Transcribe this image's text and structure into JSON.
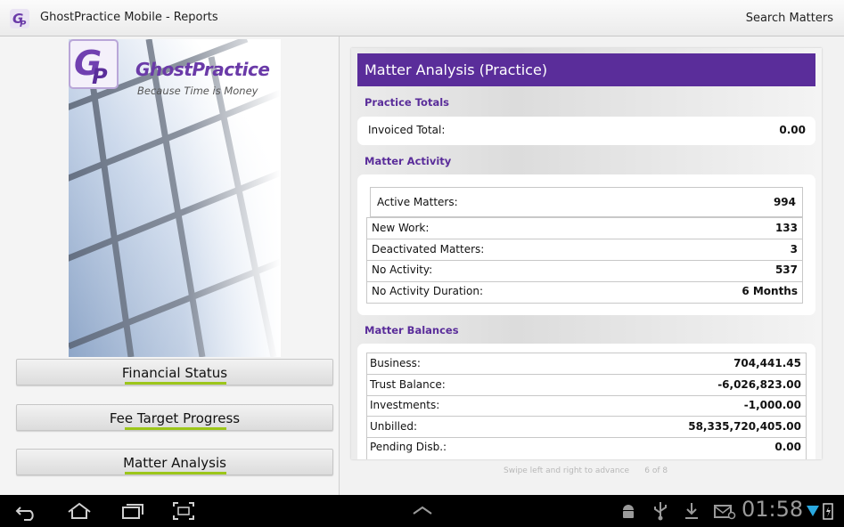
{
  "app": {
    "title": "GhostPractice Mobile - Reports",
    "search_label": "Search Matters"
  },
  "sidebar": {
    "brand": "GhostPractice",
    "tagline": "Because Time is Money",
    "items": [
      {
        "label": "Financial Status"
      },
      {
        "label": "Fee Target Progress"
      },
      {
        "label": "Matter Analysis"
      }
    ]
  },
  "report": {
    "title": "Matter Analysis (Practice)",
    "practice_totals": {
      "heading": "Practice Totals",
      "invoiced_label": "Invoiced Total:",
      "invoiced_value": "0.00"
    },
    "matter_activity": {
      "heading": "Matter Activity",
      "rows": [
        {
          "label": "Active Matters:",
          "value": "994"
        },
        {
          "label": "New Work:",
          "value": "133"
        },
        {
          "label": "Deactivated Matters:",
          "value": "3"
        },
        {
          "label": "No Activity:",
          "value": "537"
        },
        {
          "label": "No Activity Duration:",
          "value": "6 Months"
        }
      ]
    },
    "matter_balances": {
      "heading": "Matter Balances",
      "rows": [
        {
          "label": "Business:",
          "value": "704,441.45"
        },
        {
          "label": "Trust Balance:",
          "value": "-6,026,823.00"
        },
        {
          "label": "Investments:",
          "value": "-1,000.00"
        },
        {
          "label": "Unbilled:",
          "value": "58,335,720,405.00"
        },
        {
          "label": "Pending Disb.:",
          "value": "0.00"
        }
      ]
    },
    "swipe_hint": "Swipe left and right to advance",
    "page_indicator": "6 of 8"
  },
  "system_bar": {
    "clock": "01:58"
  },
  "colors": {
    "accent": "#5a2d9a",
    "nav_underline": "#9cc61a"
  }
}
